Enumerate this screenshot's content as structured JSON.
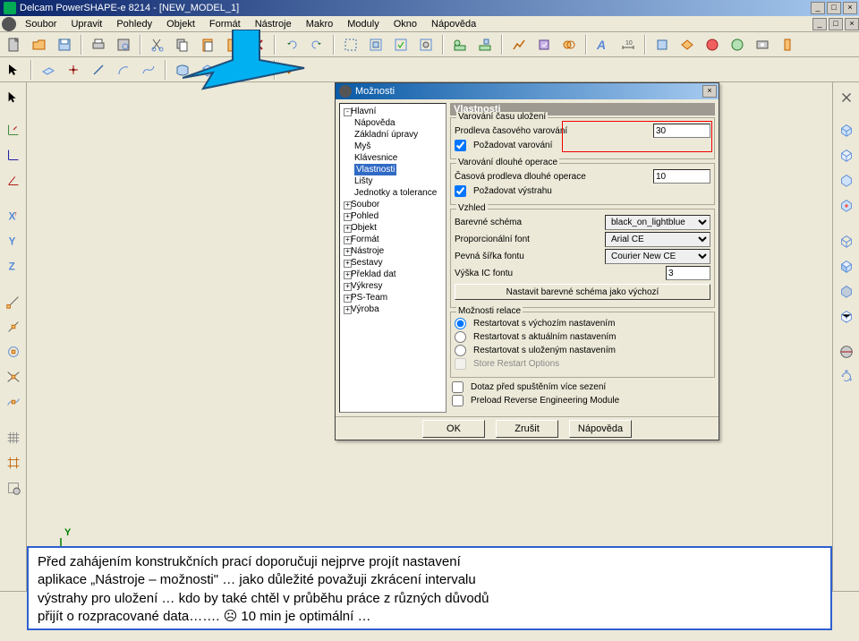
{
  "app": {
    "title": "Delcam PowerSHAPE-e 8214 - [NEW_MODEL_1]",
    "icon_name": "app-icon"
  },
  "window_controls": {
    "min": "_",
    "max": "□",
    "close": "×"
  },
  "menu": [
    "Soubor",
    "Upravit",
    "Pohledy",
    "Objekt",
    "Formát",
    "Nástroje",
    "Makro",
    "Moduly",
    "Okno",
    "Nápověda"
  ],
  "dialog": {
    "title": "Možnosti",
    "close": "×",
    "panel_header": "Vlastnosti",
    "tree": {
      "root": "Hlavní",
      "root_children": [
        "Nápověda",
        "Základní úpravy",
        "Myš",
        "Klávesnice",
        "Vlastnosti",
        "Lišty",
        "Jednotky a tolerance"
      ],
      "selected": "Vlastnosti",
      "others": [
        "Soubor",
        "Pohled",
        "Objekt",
        "Formát",
        "Nástroje",
        "Sestavy",
        "Překlad dat",
        "Výkresy",
        "PS-Team",
        "Výroba"
      ]
    },
    "save_warning": {
      "legend": "Varování času uložení",
      "delay_label": "Prodleva časového varování",
      "delay_value": "30",
      "require_label": "Požadovat varování",
      "require_checked": true
    },
    "long_op": {
      "legend": "Varování dlouhé operace",
      "delay_label": "Časová prodleva dlouhé operace",
      "delay_value": "10",
      "require_label": "Požadovat výstrahu",
      "require_checked": true
    },
    "look": {
      "legend": "Vzhled",
      "scheme_label": "Barevné schéma",
      "scheme_value": "black_on_lightblue",
      "propfont_label": "Proporcionální font",
      "propfont_value": "Arial CE",
      "fixedfont_label": "Pevná šířka fontu",
      "fixedfont_value": "Courier New CE",
      "icfont_label": "Výška IC fontu",
      "icfont_value": "3",
      "reset_btn": "Nastavit barevné schéma jako výchozí"
    },
    "session": {
      "legend": "Možnosti relace",
      "opt_default": "Restartovat s výchozím nastavením",
      "opt_current": "Restartovat s aktuálním nastavením",
      "opt_saved": "Restartovat s uloženým nastavením",
      "store_label": "Store Restart Options",
      "selected": "default",
      "ask_label": "Dotaz před spuštěním více sezení",
      "preload_label": "Preload Reverse Engineering Module"
    },
    "buttons": {
      "ok": "OK",
      "cancel": "Zrušit",
      "help": "Nápověda"
    }
  },
  "axis": {
    "x": "X",
    "y": "Y",
    "z": "Z"
  },
  "note": {
    "line1": "Před zahájením konstrukčních prací doporučuji nejprve projít nastavení",
    "line2": "aplikace „Nástroje – možnosti\" … jako důležité považuji zkrácení intervalu",
    "line3": "výstrahy pro uložení … kdo by také chtěl v průběhu práce z různých důvodů",
    "line4a": "přijít o rozpracované data…….",
    "line4_frown": "☹",
    "line4b": " 10 min je optimální …"
  }
}
